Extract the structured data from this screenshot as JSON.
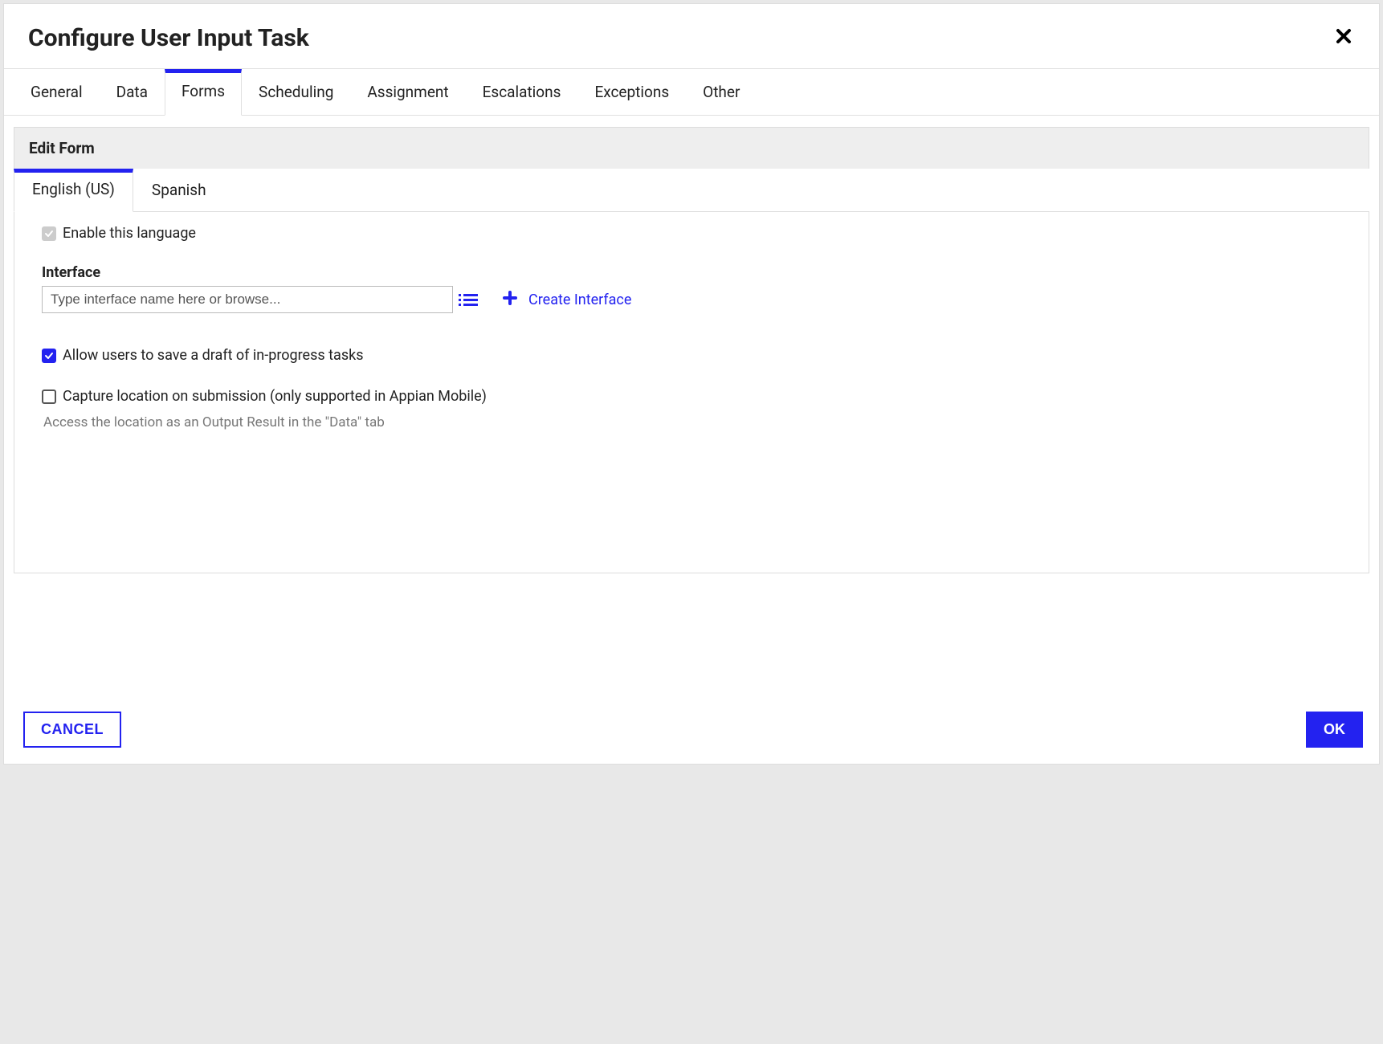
{
  "dialog": {
    "title": "Configure User Input Task"
  },
  "tabs": {
    "general": "General",
    "data": "Data",
    "forms": "Forms",
    "scheduling": "Scheduling",
    "assignment": "Assignment",
    "escalations": "Escalations",
    "exceptions": "Exceptions",
    "other": "Other",
    "active": "forms"
  },
  "section": {
    "title": "Edit Form"
  },
  "langTabs": {
    "en": "English (US)",
    "es": "Spanish",
    "active": "en"
  },
  "form": {
    "enableLangLabel": "Enable this language",
    "enableLangChecked": true,
    "interfaceLabel": "Interface",
    "interfacePlaceholder": "Type interface name here or browse...",
    "interfaceValue": "",
    "createInterfaceLabel": "Create Interface",
    "allowDraftLabel": "Allow users to save a draft of in-progress tasks",
    "allowDraftChecked": true,
    "captureLocationLabel": "Capture location on submission (only supported in Appian Mobile)",
    "captureLocationChecked": false,
    "captureLocationHint": "Access the location as an Output Result in the \"Data\" tab"
  },
  "footer": {
    "cancel": "CANCEL",
    "ok": "OK"
  },
  "colors": {
    "accent": "#2322f0"
  }
}
